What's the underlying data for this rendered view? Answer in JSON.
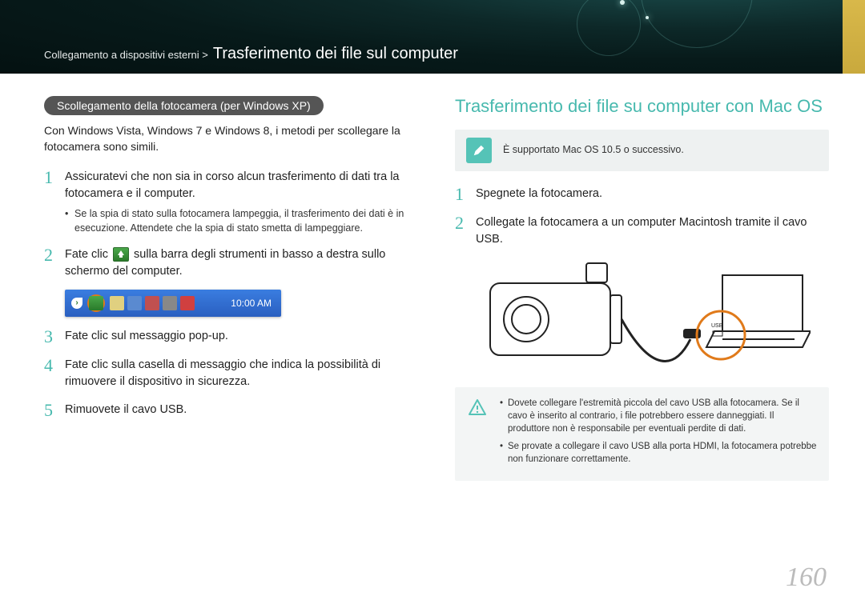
{
  "header": {
    "breadcrumb_pre": "Collegamento a dispositivi esterni >",
    "breadcrumb_main": "Trasferimento dei file sul computer"
  },
  "left": {
    "pill": "Scollegamento della fotocamera (per Windows XP)",
    "intro": "Con Windows Vista, Windows 7 e Windows 8, i metodi per scollegare la fotocamera sono simili.",
    "steps": [
      {
        "num": "1",
        "text": "Assicuratevi che non sia in corso alcun trasferimento di dati tra la fotocamera e il computer.",
        "sub": "Se la spia di stato sulla fotocamera lampeggia, il trasferimento dei dati è in esecuzione. Attendete che la spia di stato smetta di lampeggiare."
      },
      {
        "num": "2",
        "text_pre": "Fate clic ",
        "text_post": " sulla barra degli strumenti in basso a destra sullo schermo del computer."
      },
      {
        "num": "3",
        "text": "Fate clic sul messaggio pop-up."
      },
      {
        "num": "4",
        "text": "Fate clic sulla casella di messaggio che indica la possibilità di rimuovere il dispositivo in sicurezza."
      },
      {
        "num": "5",
        "text": "Rimuovete il cavo USB."
      }
    ],
    "taskbar_time": "10:00 AM"
  },
  "right": {
    "heading": "Trasferimento dei file su computer con Mac OS",
    "info": "È supportato Mac OS 10.5 o successivo.",
    "steps": [
      {
        "num": "1",
        "text": "Spegnete la fotocamera."
      },
      {
        "num": "2",
        "text": "Collegate la fotocamera a un computer Macintosh tramite il cavo USB."
      }
    ],
    "warn": [
      "Dovete collegare l'estremità piccola del cavo USB alla fotocamera. Se il cavo è inserito al contrario, i file potrebbero essere danneggiati. Il produttore non è responsabile per eventuali perdite di dati.",
      "Se provate a collegare il cavo USB alla porta HDMI, la fotocamera potrebbe non funzionare correttamente."
    ]
  },
  "page_number": "160"
}
